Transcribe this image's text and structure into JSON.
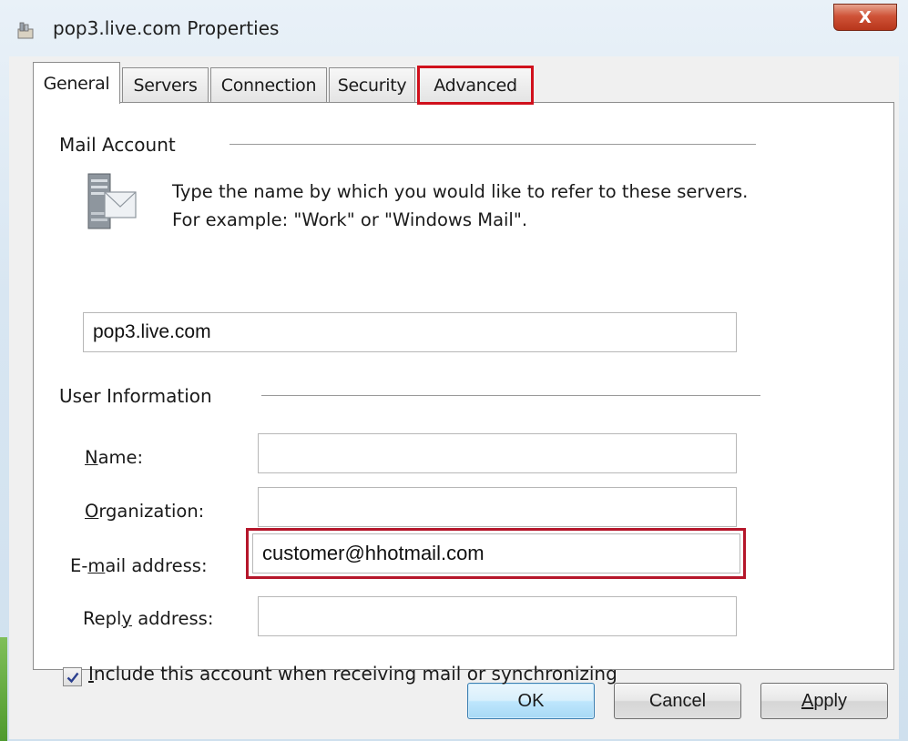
{
  "window": {
    "title": "pop3.live.com Properties",
    "close_glyph": "X"
  },
  "tabs": [
    {
      "label": "General",
      "active": true
    },
    {
      "label": "Servers",
      "active": false
    },
    {
      "label": "Connection",
      "active": false
    },
    {
      "label": "Security",
      "active": false
    },
    {
      "label": "Advanced",
      "active": false,
      "highlighted": true
    }
  ],
  "mail_account": {
    "group_label": "Mail Account",
    "description": "Type the name by which you would like to refer to these servers.  For example: \"Work\" or \"Windows Mail\".",
    "account_name_value": "pop3.live.com",
    "icon": "mail-server-icon"
  },
  "user_information": {
    "group_label": "User Information",
    "name": {
      "label_u": "N",
      "label_rest": "ame:",
      "value": ""
    },
    "organization": {
      "label_u": "O",
      "label_rest": "rganization:",
      "value": ""
    },
    "email": {
      "label_pre": "E-",
      "label_u": "m",
      "label_rest": "ail address:",
      "value": "customer@hhotmail.com",
      "highlighted": true
    },
    "reply": {
      "label_pre": "Repl",
      "label_u": "y",
      "label_rest": " address:",
      "value": ""
    }
  },
  "include_checkbox": {
    "checked": true,
    "label_u": "I",
    "label_rest": "nclude this account when receiving mail or synchronizing"
  },
  "buttons": {
    "ok": "OK",
    "cancel": "Cancel",
    "apply_u": "A",
    "apply_rest": "pply"
  },
  "colors": {
    "highlight": "#d0101c",
    "close_button": "#c8462a",
    "default_button_border": "#3c7fb1"
  }
}
